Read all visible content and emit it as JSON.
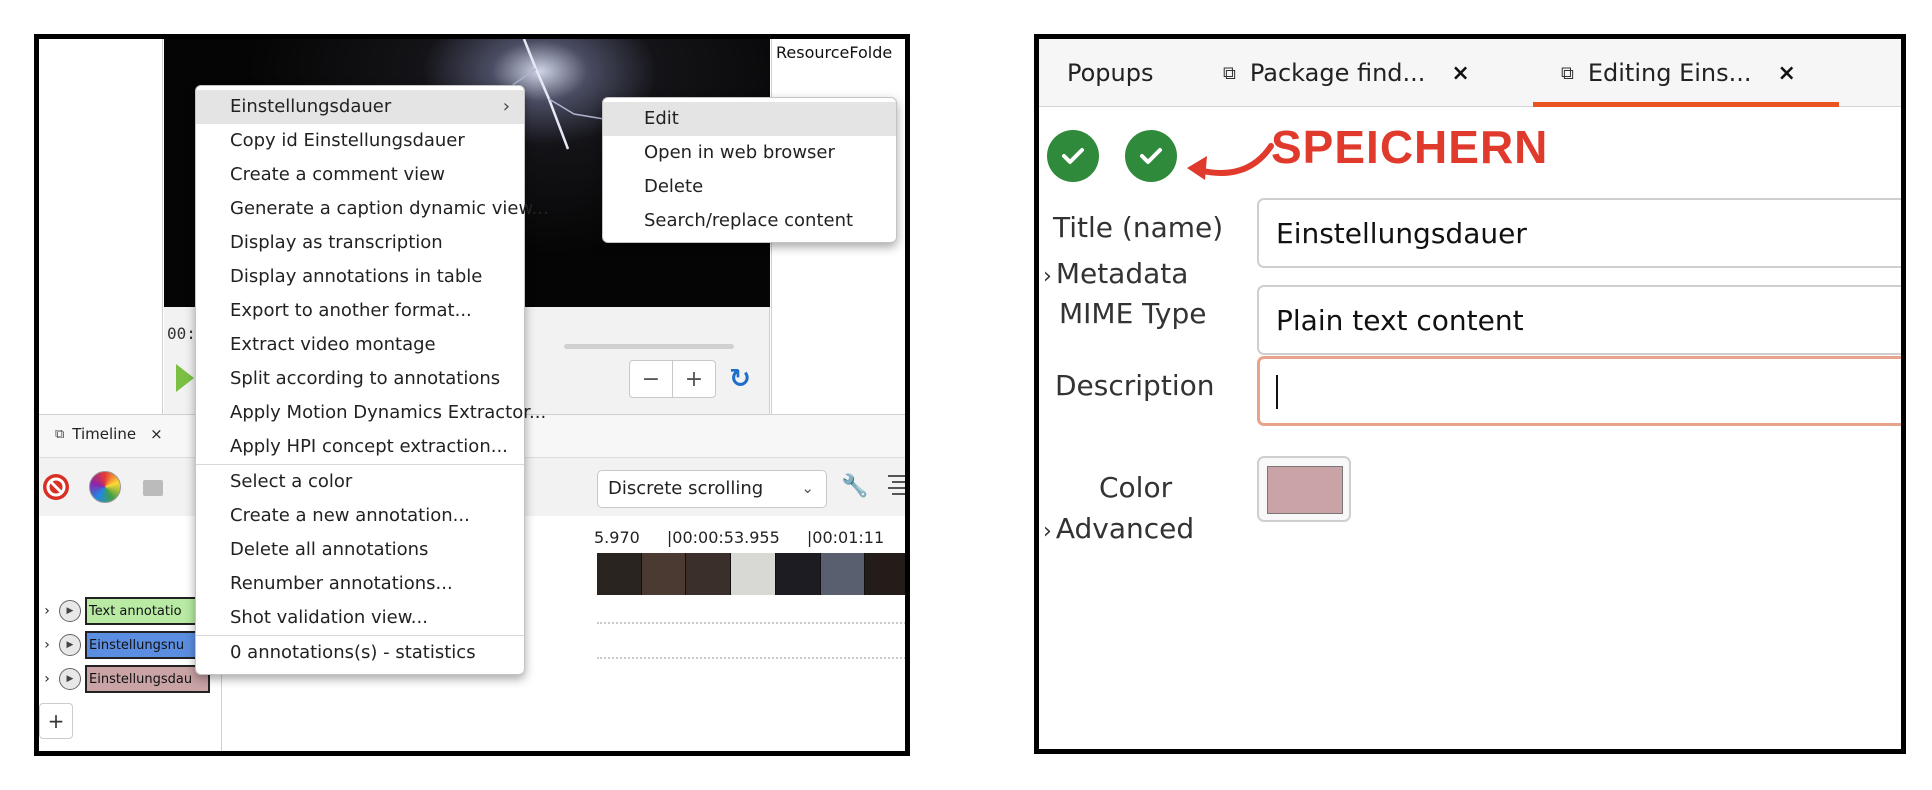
{
  "colors": {
    "accent_orange": "#e95420",
    "save_green": "#2f8a3b",
    "annotation_red": "#e03a2c",
    "track_text_annotation": "#b8eaa4",
    "track_einstellungsnummer": "#5b8ee0",
    "track_einstellungsdauer": "#c9a3a5",
    "selected_color": "#c9a3a5"
  },
  "left": {
    "resource_folder_label": "ResourceFolde",
    "video": {
      "time_display": "00:"
    },
    "timeline": {
      "tab_label": "Timeline",
      "tab_close": "×",
      "scrolling_mode": "Discrete scrolling",
      "time_ruler": [
        "5.970",
        "|00:00:53.955",
        "|00:01:11"
      ],
      "tracks": [
        {
          "label": "Text annotatio"
        },
        {
          "label": "Einstellungsnu"
        },
        {
          "label": "Einstellungsdau"
        }
      ],
      "add_track_label": "+"
    },
    "context_menu": {
      "items": [
        {
          "label": "Einstellungsdauer",
          "has_submenu": true,
          "submenu_arrow": "›"
        },
        {
          "label": "Copy id Einstellungsdauer"
        },
        {
          "label": "Create a comment view"
        },
        {
          "label": "Generate a caption dynamic view..."
        },
        {
          "label": "Display as transcription"
        },
        {
          "label": "Display annotations in table"
        },
        {
          "label": "Export to another format..."
        },
        {
          "label": "Extract video montage"
        },
        {
          "label": "Split according to annotations"
        },
        {
          "label": "Apply Motion Dynamics Extractor..."
        },
        {
          "label": "Apply HPI concept extraction..."
        },
        {
          "label": "Select a color"
        },
        {
          "label": "Create a new annotation..."
        },
        {
          "label": "Delete all annotations"
        },
        {
          "label": "Renumber annotations..."
        },
        {
          "label": "Shot validation view..."
        },
        {
          "label": "0 annotations(s) - statistics"
        }
      ],
      "submenu": [
        "Edit",
        "Open in web browser",
        "Delete",
        "Search/replace content"
      ]
    },
    "zoom": {
      "minus": "−",
      "plus": "+"
    }
  },
  "right": {
    "tabs": [
      {
        "label": "Popups"
      },
      {
        "label": "Package find...",
        "close": "×"
      },
      {
        "label": "Editing Eins...",
        "close": "×"
      }
    ],
    "annotation_text": "SPEICHERN",
    "form": {
      "title_label": "Title (name)",
      "title_value": "Einstellungsdauer",
      "metadata_label": "Metadata",
      "mime_label": "MIME Type",
      "mime_value": "Plain text content",
      "description_label": "Description",
      "description_value": "",
      "color_label": "Color",
      "advanced_label": "Advanced"
    }
  }
}
